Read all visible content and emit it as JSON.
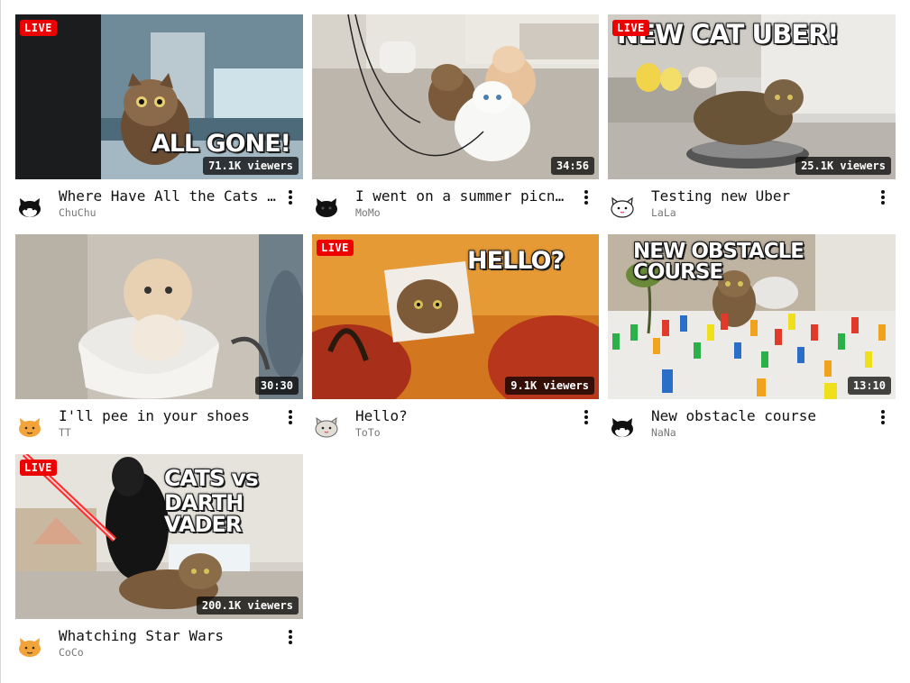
{
  "live_label": "LIVE",
  "videos": [
    {
      "title": "Where Have All the Cats …",
      "channel": "ChuChu",
      "live": true,
      "stat": "71.1K viewers",
      "overlay": "ALL GONE!",
      "avatar": "black-white-cat-icon"
    },
    {
      "title": "I went on a summer picnic",
      "channel": "MoMo",
      "live": false,
      "stat": "34:56",
      "overlay": "",
      "avatar": "black-cat-icon"
    },
    {
      "title": "Testing new Uber",
      "channel": "LaLa",
      "live": true,
      "stat": "25.1K viewers",
      "overlay": "NEW CAT UBER!",
      "avatar": "white-cat-icon"
    },
    {
      "title": "I'll pee in your shoes",
      "channel": "TT",
      "live": false,
      "stat": "30:30",
      "overlay": "",
      "avatar": "orange-cat-icon"
    },
    {
      "title": "Hello?",
      "channel": "ToTo",
      "live": true,
      "stat": "9.1K viewers",
      "overlay": "HELLO?",
      "avatar": "gray-cat-icon"
    },
    {
      "title": "New obstacle course",
      "channel": "NaNa",
      "live": false,
      "stat": "13:10",
      "overlay": "NEW OBSTACLE COURSE",
      "avatar": "black-white-cat-icon"
    },
    {
      "title": "Whatching Star Wars",
      "channel": "CoCo",
      "live": true,
      "stat": "200.1K viewers",
      "overlay_line1": "CATS vs",
      "overlay_line2": "DARTH VADER",
      "avatar": "orange-cat-icon"
    }
  ]
}
